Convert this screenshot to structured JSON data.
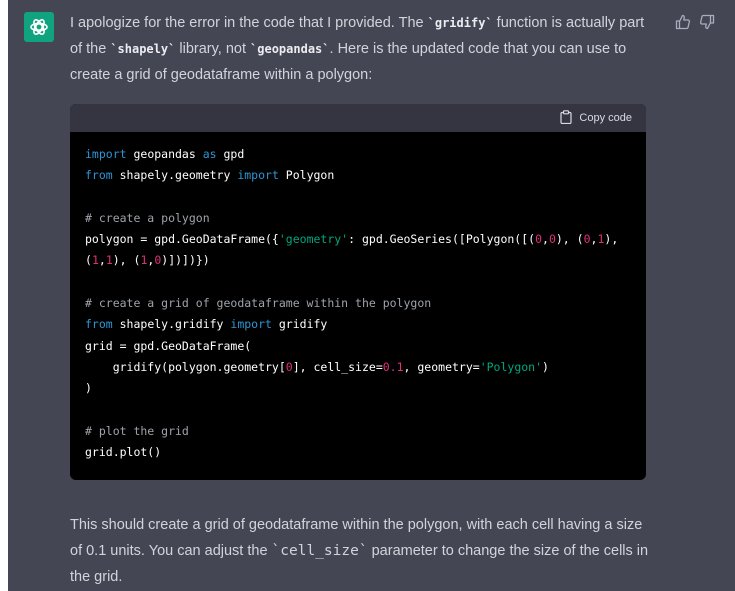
{
  "message": {
    "intro": {
      "p1": "I apologize for the error in the code that I provided. The ",
      "code1": "`gridify`",
      "p2": " function is actually part of the ",
      "code2": "`shapely`",
      "p3": " library, not ",
      "code3": "`geopandas`",
      "p4": ". Here is the updated code that you can use to create a grid of geodataframe within a polygon:"
    },
    "code_block": {
      "copy_label": "Copy code",
      "lines": {
        "l1": {
          "a": "import",
          "b": " geopandas ",
          "c": "as",
          "d": " gpd"
        },
        "l2": {
          "a": "from",
          "b": " shapely.geometry ",
          "c": "import",
          "d": " Polygon"
        },
        "l4": "# create a polygon",
        "l5": {
          "a": "polygon = gpd.GeoDataFrame({",
          "b": "'geometry'",
          "c": ": gpd.GeoSeries([Polygon([(",
          "d": "0",
          "e": ",",
          "f": "0",
          "g": "), (",
          "h": "0",
          "i": ",",
          "j": "1",
          "k": "),"
        },
        "l6": {
          "a": "(",
          "b": "1",
          "c": ",",
          "d": "1",
          "e": "), (",
          "f": "1",
          "g": ",",
          "h": "0",
          "i": ")])])})"
        },
        "l8": "# create a grid of geodataframe within the polygon",
        "l9": {
          "a": "from",
          "b": " shapely.gridify ",
          "c": "import",
          "d": " gridify"
        },
        "l10": "grid = gpd.GeoDataFrame(",
        "l11": {
          "a": "    gridify(polygon.geometry[",
          "b": "0",
          "c": "], cell_size=",
          "d": "0.1",
          "e": ", geometry=",
          "f": "'Polygon'",
          "g": ")"
        },
        "l12": ")",
        "l14": "# plot the grid",
        "l15": "grid.plot()"
      }
    },
    "outro": {
      "p1": "This should create a grid of geodataframe within the polygon, with each cell having a size of 0.1 units. You can adjust the ",
      "code1": "`cell_size`",
      "p2": " parameter to change the size of the cells in the grid."
    }
  },
  "icons": {
    "avatar": "openai-logo-icon",
    "thumbs_up": "thumbs-up-icon",
    "thumbs_down": "thumbs-down-icon",
    "copy": "clipboard-icon"
  },
  "colors": {
    "message_bg": "#444654",
    "avatar_bg": "#10a37f",
    "code_bg": "#000000",
    "code_header_bg": "#343541",
    "keyword": "#2e95d3",
    "string": "#00a67d",
    "number": "#df3079",
    "comment": "#9ea3ab"
  }
}
